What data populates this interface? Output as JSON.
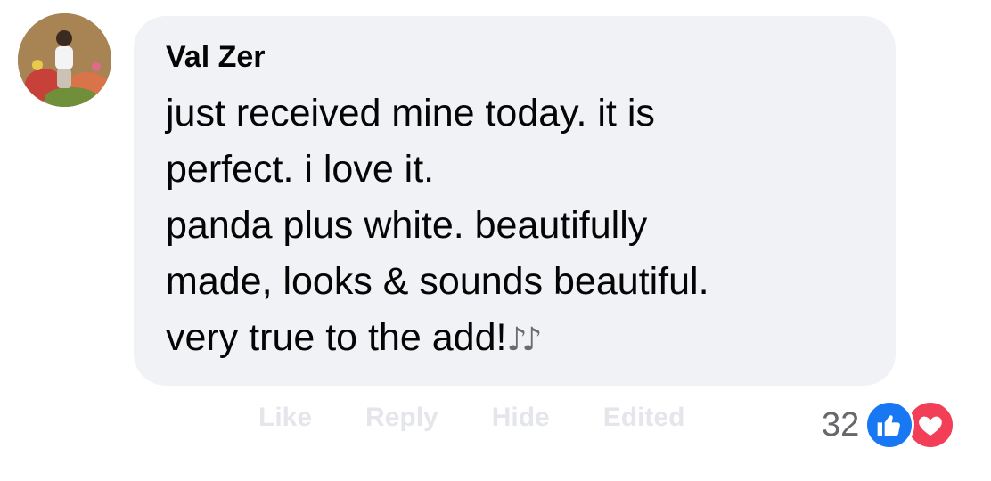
{
  "comment": {
    "author": "Val Zer",
    "lines": [
      "just received mine today. it is",
      "perfect. i love it.",
      "panda plus white. beautifully",
      "made, looks & sounds beautiful.",
      "very true to the add!"
    ],
    "emoji": "♪♪"
  },
  "actions": {
    "like": "Like",
    "reply": "Reply",
    "hide": "Hide",
    "edited": "Edited"
  },
  "reactions": {
    "count": "32",
    "types": [
      "like-icon",
      "love-icon"
    ]
  },
  "colors": {
    "bubble": "#f0f2f5",
    "like": "#1877f2",
    "love": "#f33e58"
  }
}
